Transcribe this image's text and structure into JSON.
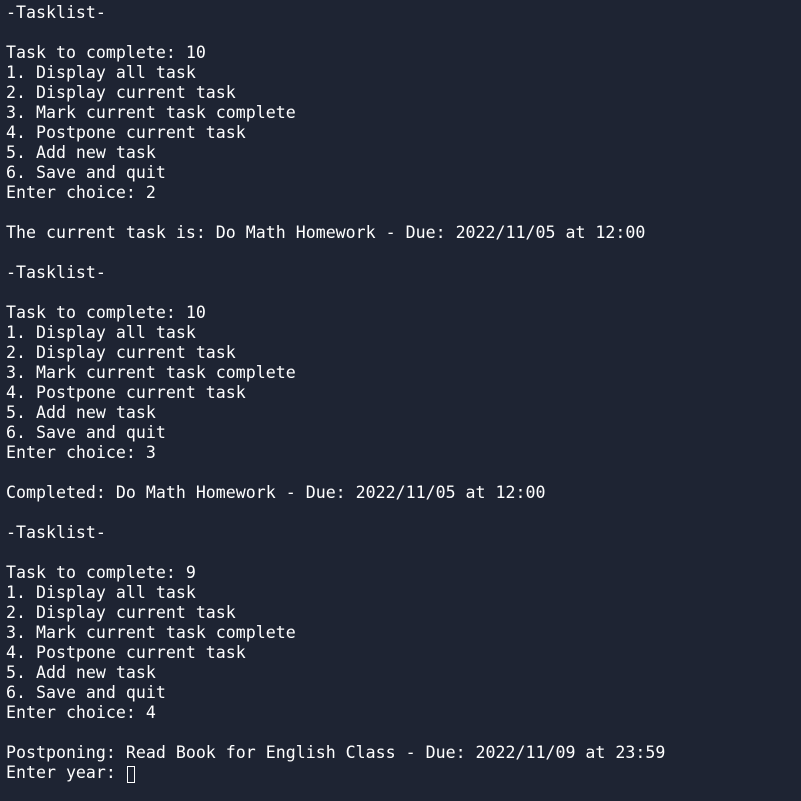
{
  "terminal": {
    "lines": [
      "-Tasklist-",
      "",
      "Task to complete: 10",
      "1. Display all task",
      "2. Display current task",
      "3. Mark current task complete",
      "4. Postpone current task",
      "5. Add new task",
      "6. Save and quit",
      "Enter choice: 2",
      "",
      "The current task is: Do Math Homework - Due: 2022/11/05 at 12:00",
      "",
      "-Tasklist-",
      "",
      "Task to complete: 10",
      "1. Display all task",
      "2. Display current task",
      "3. Mark current task complete",
      "4. Postpone current task",
      "5. Add new task",
      "6. Save and quit",
      "Enter choice: 3",
      "",
      "Completed: Do Math Homework - Due: 2022/11/05 at 12:00",
      "",
      "-Tasklist-",
      "",
      "Task to complete: 9",
      "1. Display all task",
      "2. Display current task",
      "3. Mark current task complete",
      "4. Postpone current task",
      "5. Add new task",
      "6. Save and quit",
      "Enter choice: 4",
      "",
      "Postponing: Read Book for English Class - Due: 2022/11/09 at 23:59"
    ],
    "prompt": "Enter year: "
  },
  "colors": {
    "background": "#1e2433",
    "text": "#ffffff"
  }
}
